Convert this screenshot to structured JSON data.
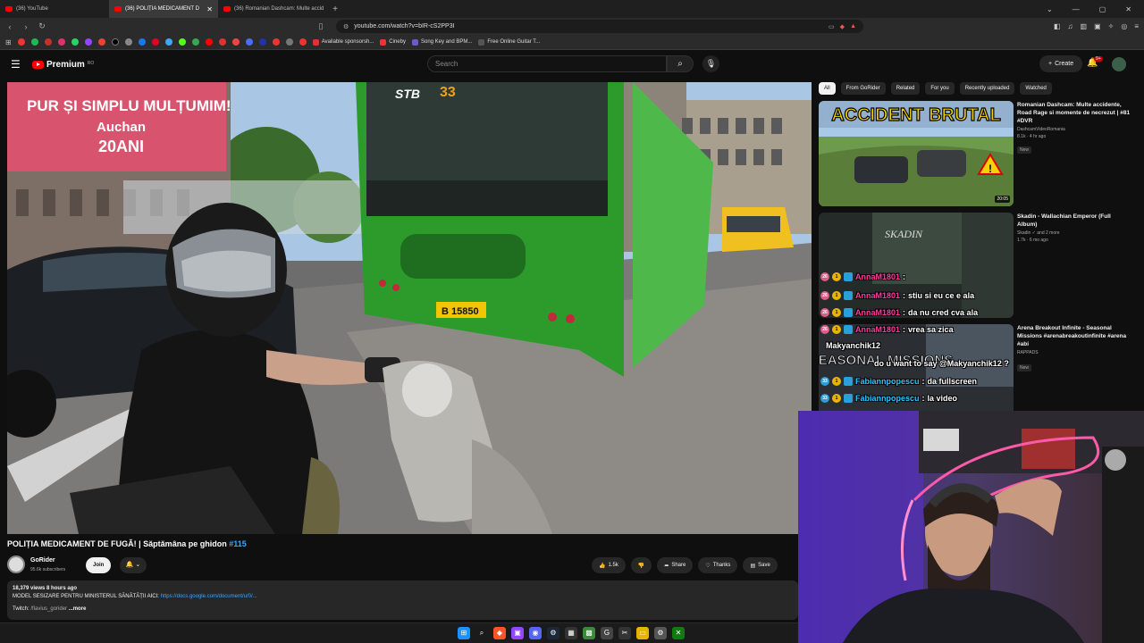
{
  "browser": {
    "tabs": [
      {
        "label": "(36) YouTube",
        "active": false
      },
      {
        "label": "(36) POLIȚIA MEDICAMENT D",
        "active": true
      },
      {
        "label": "(36) Romanian Dashcam: Multe accid",
        "active": false
      }
    ],
    "url": "youtube.com/watch?v=bIR-cS2PP3I",
    "bookmarks": [
      "Available sponsorsh...",
      "Cineby",
      "Song Key and BPM...",
      "Free Online Guitar T..."
    ]
  },
  "header": {
    "brand": "Premium",
    "brand_sup": "RO",
    "search_placeholder": "Search",
    "create_label": "Create",
    "notif_count": "9+"
  },
  "video": {
    "billboard_line1": "PUR ȘI SIMPLU MULȚUMIM!",
    "billboard_brand": "Auchan",
    "billboard_years": "20ANI",
    "bus_route": "33",
    "bus_brand": "STB",
    "plate": "B 15850"
  },
  "meta": {
    "title": "POLIȚIA MEDICAMENT DE FUGĂ! | Săptămâna pe ghidon",
    "title_tag": "#115",
    "channel": "GoRider",
    "subs": "95.6k subscribers",
    "join_label": "Join",
    "like_count": "1.5k",
    "share_label": "Share",
    "thanks_label": "Thanks",
    "save_label": "Save"
  },
  "description": {
    "stats": "18,379 views  8 hours ago",
    "line1_text": "MODEL SESIZARE PENTRU MINISTERUL SĂNĂTĂȚII AICI:",
    "line1_link": "https://docs.google.com/document/u/0/...",
    "twitch_label": "Twitch:",
    "twitch_handle": "/flavius_gorider",
    "more": "...more"
  },
  "chips": [
    "All",
    "From GoRider",
    "Related",
    "For you",
    "Recently uploaded",
    "Watched"
  ],
  "recommendations": [
    {
      "thumb_text": "ACCIDENT BRUTAL",
      "title": "Romanian Dashcam: Multe accidente, Road Rage si momente de necrezut | #81 #DVR",
      "channel": "DashcamVideoRomania",
      "views": "8.1k · 4 hr ago",
      "badge": "New",
      "duration": "20:05"
    },
    {
      "thumb_text": "SKADIN",
      "title": "Skadin - Wallachian Emperor (Full Album)",
      "channel": "Skadin ✓ and 2 more",
      "views": "1.7k · 6 mo ago",
      "badge": "",
      "duration": ""
    },
    {
      "thumb_text": "SEASONAL MISSIONS",
      "title": "Arena Breakout Infinite - Seasonal Missions #arenabreakoutinfinite #arena #abi",
      "channel": "RAPPADS",
      "views": "",
      "badge": "New",
      "duration": ""
    }
  ],
  "chat": [
    {
      "lvl": "26",
      "user": "AnnaM1801",
      "sep": ":",
      "msg": ""
    },
    {
      "lvl": "26",
      "user": "AnnaM1801",
      "sep": ":",
      "msg": "stiu si eu ce e ala"
    },
    {
      "lvl": "26",
      "user": "AnnaM1801",
      "sep": ":",
      "msg": "da nu cred cva ala"
    },
    {
      "lvl": "26",
      "user": "AnnaM1801",
      "sep": ":",
      "msg": "vrea sa zica"
    },
    {
      "lvl": "",
      "user": "Makyanchik12",
      "sep": "",
      "msg": ""
    },
    {
      "lvl": "",
      "user": "",
      "sep": "",
      "msg": "do u want to say @Makyanchik12 ?"
    },
    {
      "lvl": "33",
      "user": "Fabiannpopescu",
      "sep": ":",
      "msg": "da fullscreen"
    },
    {
      "lvl": "33",
      "user": "Fabiannpopescu",
      "sep": ":",
      "msg": "la video"
    }
  ]
}
